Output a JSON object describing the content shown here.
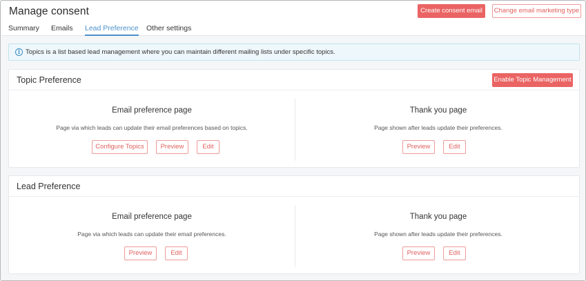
{
  "header": {
    "title": "Manage consent",
    "create_button": "Create consent email",
    "change_button": "Change email marketing type"
  },
  "tabs": [
    {
      "label": "Summary"
    },
    {
      "label": "Emails"
    },
    {
      "label": "Lead Preference"
    },
    {
      "label": "Other settings"
    }
  ],
  "active_tab": "Lead Preference",
  "info": {
    "icon": "info-icon",
    "text": "Topics is a list based lead management where you can maintain different mailing lists under specific topics."
  },
  "topic_preference": {
    "title": "Topic Preference",
    "enable_button": "Enable Topic Management",
    "email_page": {
      "title": "Email preference page",
      "description": "Page via which leads can update their email preferences based on topics.",
      "buttons": [
        "Configure Topics",
        "Preview",
        "Edit"
      ]
    },
    "thank_you_page": {
      "title": "Thank you page",
      "description": "Page shown after leads update their preferences.",
      "buttons": [
        "Preview",
        "Edit"
      ]
    }
  },
  "lead_preference": {
    "title": "Lead Preference",
    "email_page": {
      "title": "Email preference page",
      "description": "Page via which leads can update their email preferences.",
      "buttons": [
        "Preview",
        "Edit"
      ]
    },
    "thank_you_page": {
      "title": "Thank you page",
      "description": "Page shown after leads update their preferences.",
      "buttons": [
        "Preview",
        "Edit"
      ]
    }
  },
  "colors": {
    "accent": "#ea6463",
    "tab_active": "#4a90c8",
    "info_bg": "#eef7fb"
  }
}
